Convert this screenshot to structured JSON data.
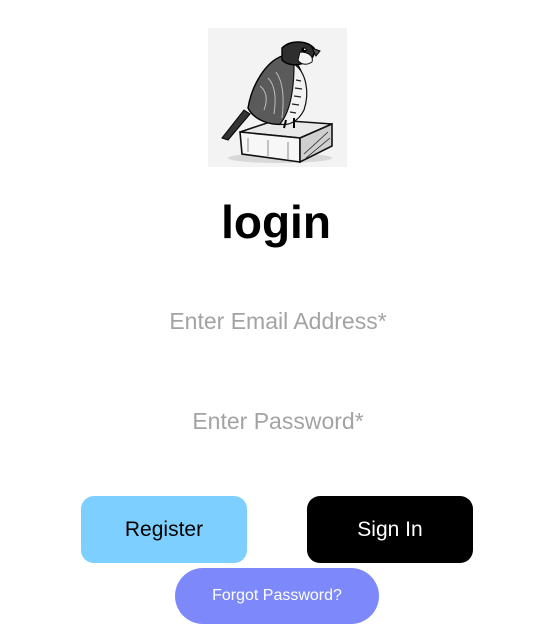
{
  "logo": {
    "icon": "falcon-on-box-icon"
  },
  "title": "login",
  "email": {
    "placeholder": "Enter Email Address*",
    "value": ""
  },
  "password": {
    "placeholder": "Enter Password*",
    "value": ""
  },
  "buttons": {
    "register": "Register",
    "sign_in": "Sign In",
    "forgot": "Forgot Password?"
  },
  "colors": {
    "register_bg": "#7ccfff",
    "sign_in_bg": "#000000",
    "forgot_bg": "#7d89fb",
    "placeholder": "#a3a3a3"
  }
}
